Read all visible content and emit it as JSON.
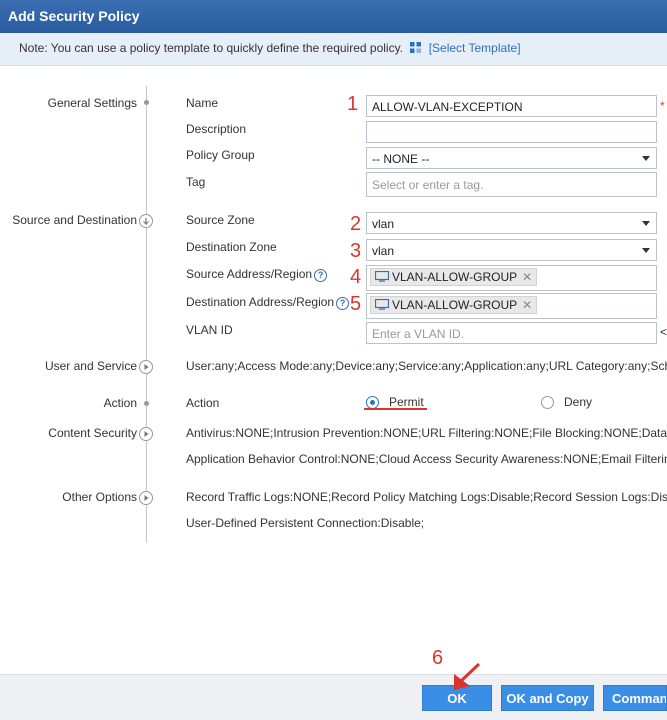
{
  "window": {
    "title": "Add Security Policy"
  },
  "note": {
    "text": "Note: You can use a policy template to quickly define the required policy.",
    "link": "[Select Template]"
  },
  "sections": {
    "general": "General Settings",
    "source_dest": "Source and Destination",
    "user_service": "User and Service",
    "action": "Action",
    "content_security": "Content Security",
    "other": "Other Options"
  },
  "fields": {
    "name": {
      "label": "Name",
      "value": "ALLOW-VLAN-EXCEPTION",
      "required_mark": "*"
    },
    "description": {
      "label": "Description",
      "value": ""
    },
    "policy_group": {
      "label": "Policy Group",
      "value": "-- NONE --"
    },
    "tag": {
      "label": "Tag",
      "placeholder": "Select or enter a tag."
    },
    "source_zone": {
      "label": "Source Zone",
      "value": "vlan"
    },
    "destination_zone": {
      "label": "Destination Zone",
      "value": "vlan"
    },
    "source_address": {
      "label": "Source Address/Region",
      "chip": "VLAN-ALLOW-GROUP",
      "chip_close": "✕"
    },
    "destination_address": {
      "label": "Destination Address/Region",
      "chip": "VLAN-ALLOW-GROUP",
      "chip_close": "✕"
    },
    "vlan_id": {
      "label": "VLAN ID",
      "placeholder": "Enter a VLAN ID.",
      "trailing": "<"
    }
  },
  "help_glyph": "?",
  "user_service_summary": "User:any;Access Mode:any;Device:any;Service:any;Application:any;URL Category:any;Sche",
  "action": {
    "label": "Action",
    "permit": "Permit",
    "deny": "Deny",
    "selected": "Permit"
  },
  "content_security": {
    "line1": "Antivirus:NONE;Intrusion Prevention:NONE;URL Filtering:NONE;File Blocking:NONE;Data",
    "line2": "Application Behavior Control:NONE;Cloud Access Security Awareness:NONE;Email Filterin"
  },
  "other_options": {
    "line1": "Record Traffic Logs:NONE;Record Policy Matching Logs:Disable;Record Session Logs:Dis",
    "line2": "User-Defined Persistent Connection:Disable;"
  },
  "annotations": {
    "n1": "1",
    "n2": "2",
    "n3": "3",
    "n4": "4",
    "n5": "5",
    "n6": "6"
  },
  "buttons": {
    "ok": "OK",
    "ok_copy": "OK and Copy",
    "command": "Command"
  },
  "colors": {
    "title_bar": "#2f63a8",
    "note_bg": "#e6eef8",
    "link": "#2f6fc3",
    "button": "#3a8ee6",
    "annotation": "#d9362b"
  }
}
